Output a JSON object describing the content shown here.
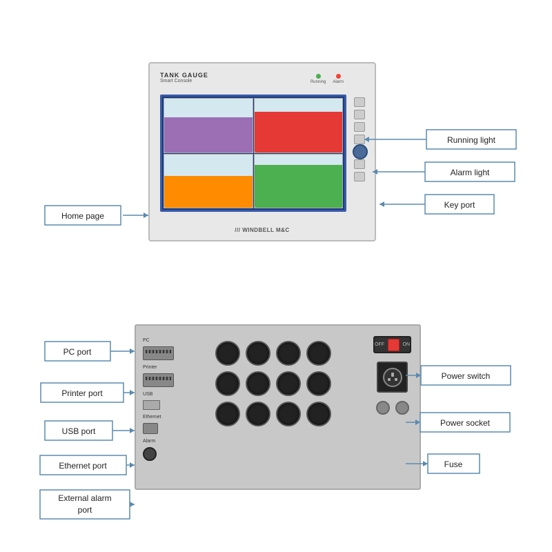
{
  "top": {
    "console": {
      "title": "TANK GAUGE",
      "subtitle": "Smart Console",
      "logo": "/// WINDBELL M&C",
      "running_light_label": "Running",
      "alarm_light_label": "Alarm"
    },
    "labels": {
      "running_light": "Running light",
      "alarm_light": "Alarm light",
      "key_port": "Key port",
      "home_page": "Home page"
    }
  },
  "bottom": {
    "labels": {
      "pc_port": "PC port",
      "printer_port": "Printer port",
      "usb_port": "USB port",
      "ethernet_port": "Ethernet port",
      "external_alarm_port": "External alarm port",
      "power_switch": "Power switch",
      "power_socket": "Power socket",
      "fuse": "Fuse"
    },
    "panel_ports": {
      "pc_label": "PC",
      "printer_label": "Printer",
      "usb_label": "USB",
      "ethernet_label": "Ethernet",
      "alarm_label": "Alarm"
    }
  }
}
